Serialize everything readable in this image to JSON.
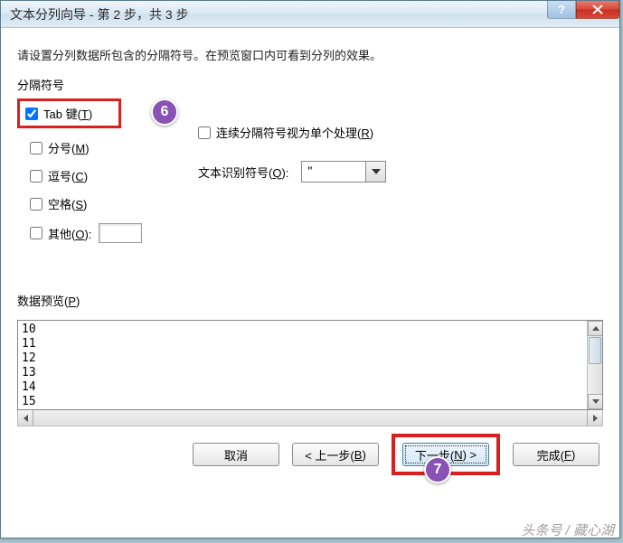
{
  "window": {
    "title": "文本分列向导 - 第 2 步，共 3 步"
  },
  "instruction": "请设置分列数据所包含的分隔符号。在预览窗口内可看到分列的效果。",
  "delimGroupLabel": "分隔符号",
  "delimiters": {
    "tab": {
      "label": "Tab 键(",
      "accel": "T",
      "tail": ")",
      "checked": true
    },
    "semicolon": {
      "label": "分号(",
      "accel": "M",
      "tail": ")",
      "checked": false
    },
    "comma": {
      "label": "逗号(",
      "accel": "C",
      "tail": ")",
      "checked": false
    },
    "space": {
      "label": "空格(",
      "accel": "S",
      "tail": ")",
      "checked": false
    },
    "other": {
      "label": "其他(",
      "accel": "O",
      "tail": "):",
      "checked": false,
      "value": ""
    }
  },
  "consecutive": {
    "label": "连续分隔符号视为单个处理(",
    "accel": "R",
    "tail": ")",
    "checked": false
  },
  "textQualifier": {
    "label": "文本识别符号(",
    "accel": "Q",
    "tail": "):",
    "value": "\""
  },
  "previewLabel": {
    "label": "数据预览(",
    "accel": "P",
    "tail": ")"
  },
  "previewLines": [
    "10",
    "11",
    "12",
    "13",
    "14",
    "15"
  ],
  "buttons": {
    "cancel": "取消",
    "back": {
      "pre": "< 上一步(",
      "accel": "B",
      "tail": ")"
    },
    "next": {
      "pre": "下一步(",
      "accel": "N",
      "tail": ") >"
    },
    "finish": {
      "pre": "完成(",
      "accel": "F",
      "tail": ")"
    }
  },
  "badges": {
    "six": "6",
    "seven": "7"
  },
  "watermark": "头条号 / 藏心湖"
}
